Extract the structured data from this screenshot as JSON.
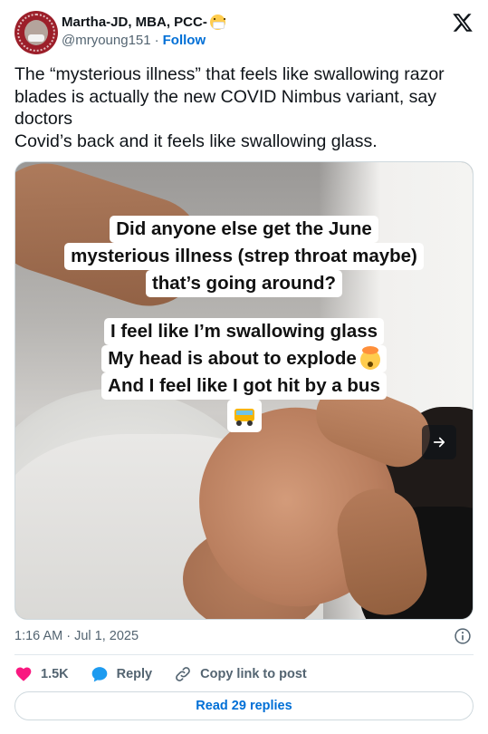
{
  "author": {
    "display_name": "Martha-JD, MBA, PCC-",
    "name_emoji": "face-with-medical-mask-icon",
    "handle": "@mryoung151",
    "separator": "·",
    "follow_label": "Follow"
  },
  "tweet": {
    "lines": [
      "The “mysterious illness” that feels like swallowing razor blades is actually the new COVID Nimbus variant, say doctors",
      "Covid’s back and it feels like swallowing glass."
    ]
  },
  "media": {
    "caption_top": [
      "Did anyone else get the June",
      "mysterious illness (strep throat maybe)",
      "that’s going around?"
    ],
    "caption_bottom": [
      "I feel like I’m swallowing glass",
      "My head is about to explode",
      "And I feel like I got hit by a bus"
    ],
    "next_icon": "arrow-right-icon"
  },
  "meta": {
    "timestamp": "1:16 AM · Jul 1, 2025"
  },
  "actions": {
    "like_count": "1.5K",
    "reply_label": "Reply",
    "copy_label": "Copy link to post"
  },
  "footer": {
    "read_replies_label": "Read 29 replies"
  },
  "colors": {
    "text": "#0f1419",
    "secondary": "#536471",
    "link": "#006fd6",
    "like": "#f91880",
    "reply": "#1d9bf0",
    "border": "#cfd9de"
  }
}
